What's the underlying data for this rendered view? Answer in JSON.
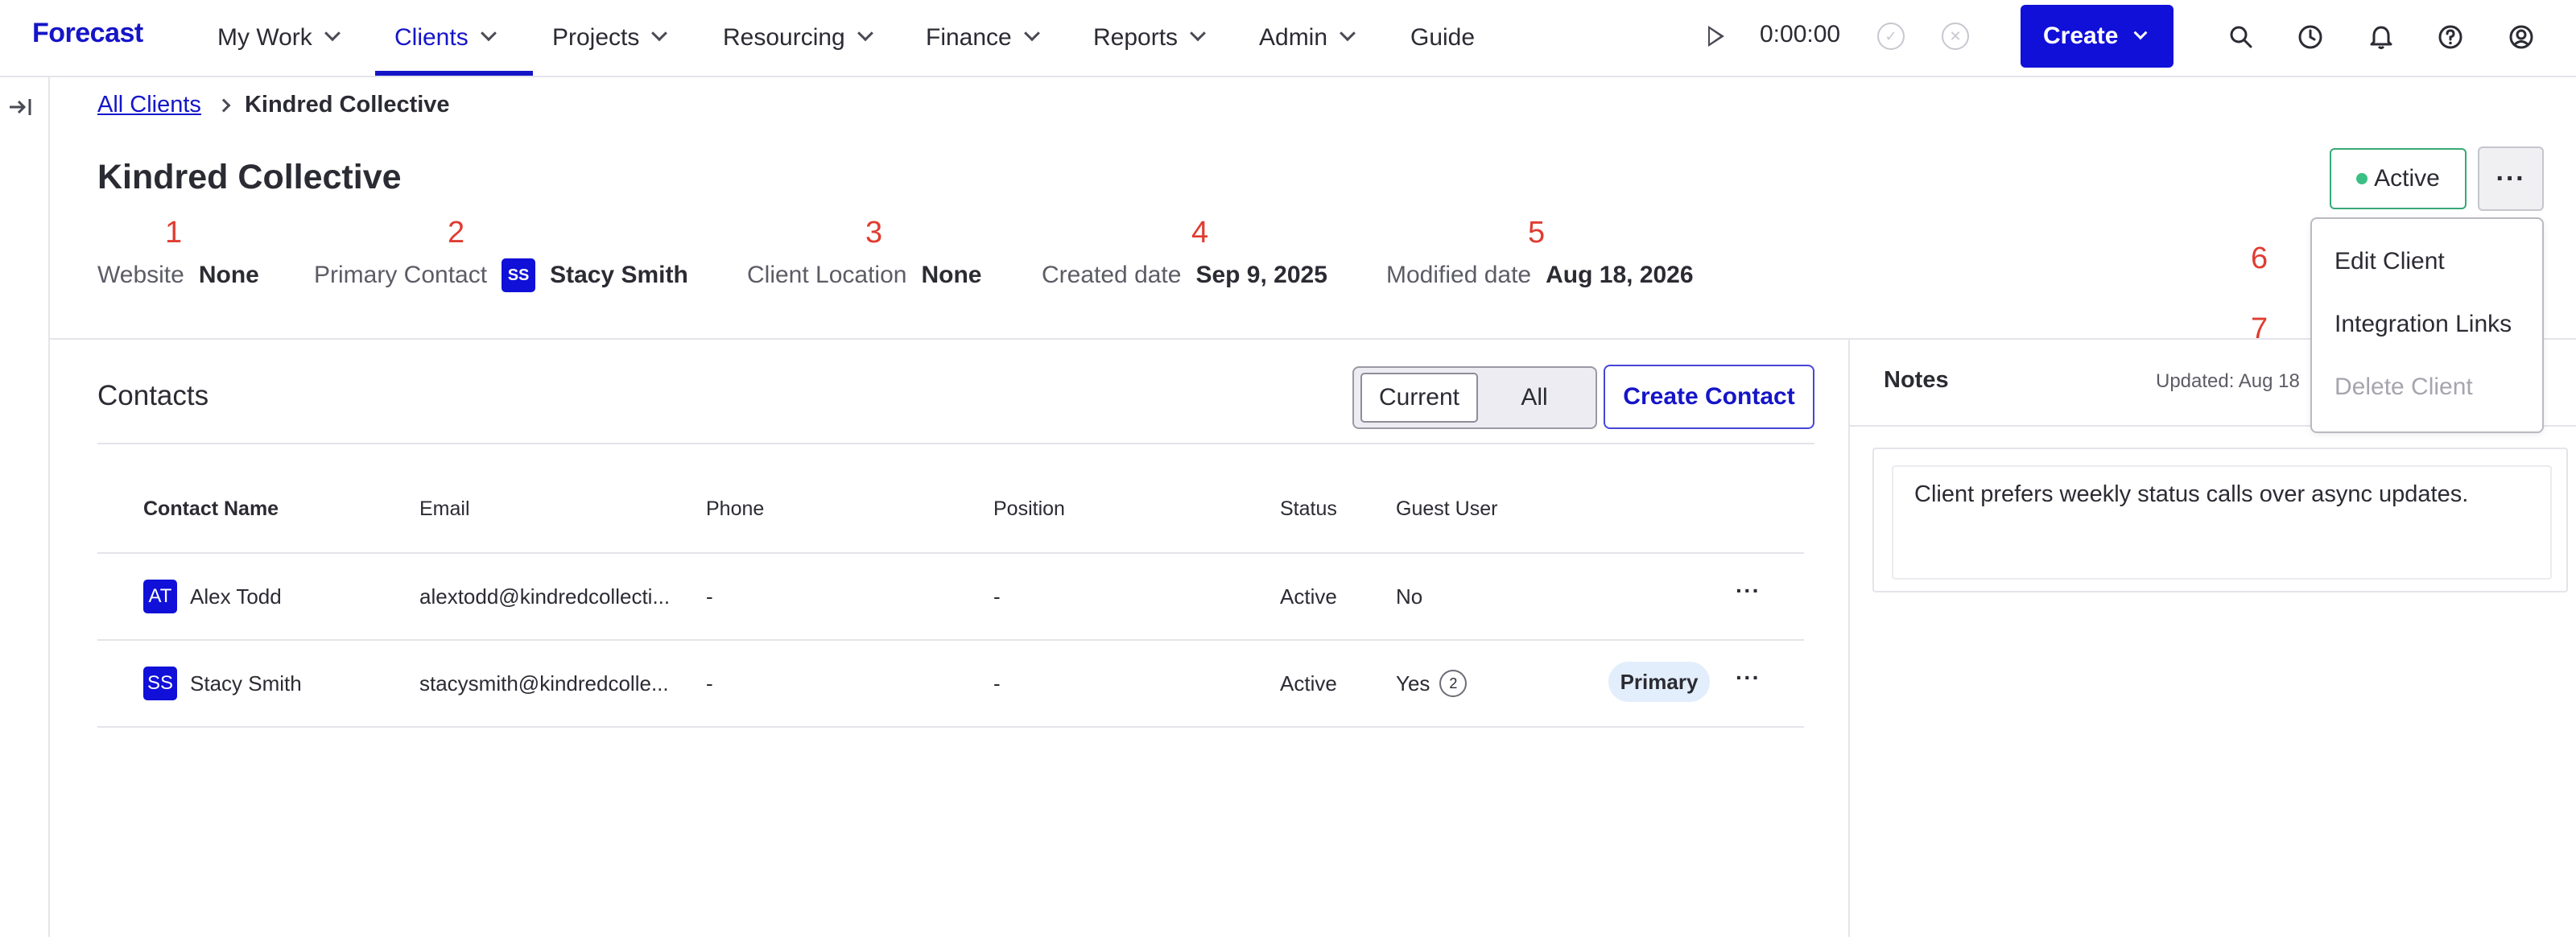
{
  "app": {
    "logo": "Forecast"
  },
  "nav": {
    "items": [
      {
        "label": "My Work",
        "has_chevron": true
      },
      {
        "label": "Clients",
        "has_chevron": true,
        "active": true
      },
      {
        "label": "Projects",
        "has_chevron": true
      },
      {
        "label": "Resourcing",
        "has_chevron": true
      },
      {
        "label": "Finance",
        "has_chevron": true
      },
      {
        "label": "Reports",
        "has_chevron": true
      },
      {
        "label": "Admin",
        "has_chevron": true
      },
      {
        "label": "Guide",
        "has_chevron": false
      }
    ],
    "timer": "0:00:00",
    "create_label": "Create",
    "accent_color": "#1010d8"
  },
  "breadcrumb": {
    "parent": "All Clients",
    "current": "Kindred Collective"
  },
  "client": {
    "name": "Kindred Collective",
    "status": "Active",
    "status_color": "#38a877",
    "more_label": "···",
    "fields": [
      {
        "marker": "1",
        "label": "Website",
        "value": "None"
      },
      {
        "marker": "2",
        "label": "Primary Contact",
        "initials": "SS",
        "value": "Stacy Smith"
      },
      {
        "marker": "3",
        "label": "Client Location",
        "value": "None"
      },
      {
        "marker": "4",
        "label": "Created date",
        "value": "Sep 9, 2025"
      },
      {
        "marker": "5",
        "label": "Modified date",
        "value": "Aug 18, 2026"
      }
    ]
  },
  "menu": {
    "items": [
      {
        "marker": "6",
        "label": "Edit Client",
        "disabled": false
      },
      {
        "marker": "7",
        "label": "Integration Links",
        "disabled": false
      },
      {
        "label": "Delete Client",
        "disabled": true
      }
    ]
  },
  "contacts": {
    "title": "Contacts",
    "toggle": {
      "current": "Current",
      "all": "All",
      "selected": "Current"
    },
    "create_label": "Create Contact",
    "columns": [
      "Contact Name",
      "Email",
      "Phone",
      "Position",
      "Status",
      "Guest User"
    ],
    "rows": [
      {
        "initials": "AT",
        "name": "Alex Todd",
        "email": "alextodd@kindredcollecti...",
        "phone": "-",
        "position": "-",
        "status": "Active",
        "guest": "No",
        "guest_count": "",
        "primary": ""
      },
      {
        "initials": "SS",
        "name": "Stacy Smith",
        "email": "stacysmith@kindredcolle...",
        "phone": "-",
        "position": "-",
        "status": "Active",
        "guest": "Yes",
        "guest_count": "2",
        "primary": "Primary"
      }
    ],
    "row_more": "···"
  },
  "notes": {
    "title": "Notes",
    "updated": "Updated: Aug 18",
    "text": "Client prefers weekly status calls over async updates."
  }
}
